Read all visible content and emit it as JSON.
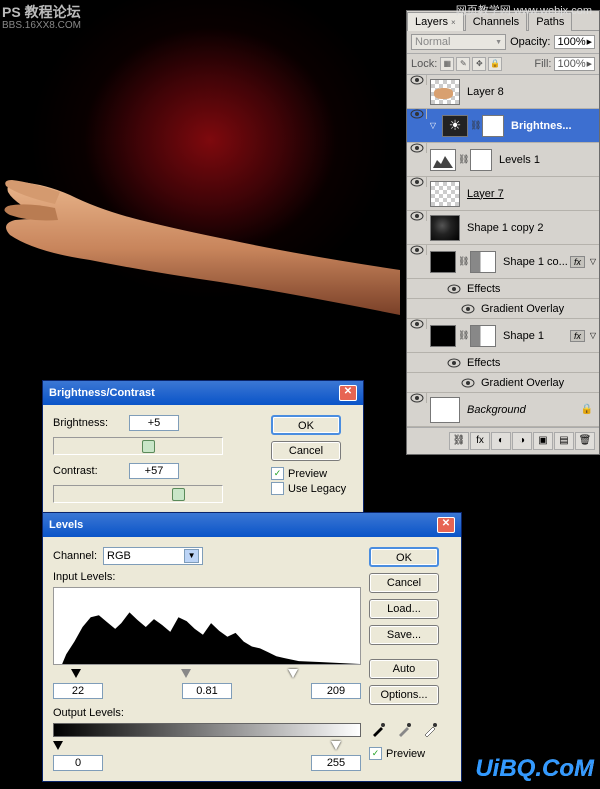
{
  "watermarks": {
    "top_left": "PS 教程论坛",
    "top_left_sub": "BBS.16XX8.COM",
    "top_right": "网页教学网\nwww.webjx.com",
    "bottom_right": "UiBQ.CoM"
  },
  "brightness_contrast": {
    "title": "Brightness/Contrast",
    "brightness_label": "Brightness:",
    "brightness_value": "+5",
    "contrast_label": "Contrast:",
    "contrast_value": "+57",
    "ok": "OK",
    "cancel": "Cancel",
    "preview": "Preview",
    "use_legacy": "Use Legacy"
  },
  "levels": {
    "title": "Levels",
    "channel_label": "Channel:",
    "channel_value": "RGB",
    "input_label": "Input Levels:",
    "input_black": "22",
    "input_mid": "0.81",
    "input_white": "209",
    "output_label": "Output Levels:",
    "output_black": "0",
    "output_white": "255",
    "ok": "OK",
    "cancel": "Cancel",
    "load": "Load...",
    "save": "Save...",
    "auto": "Auto",
    "options": "Options...",
    "preview": "Preview"
  },
  "layers_panel": {
    "tabs": {
      "layers": "Layers",
      "channels": "Channels",
      "paths": "Paths"
    },
    "blend_mode": "Normal",
    "opacity_label": "Opacity:",
    "opacity_value": "100%",
    "lock_label": "Lock:",
    "fill_label": "Fill:",
    "fill_value": "100%",
    "layers": [
      {
        "name": "Layer 8",
        "type": "raster"
      },
      {
        "name": "Brightnes...",
        "type": "adjust",
        "selected": true
      },
      {
        "name": "Levels 1",
        "type": "adjust"
      },
      {
        "name": "Layer 7",
        "type": "raster",
        "underline": true
      },
      {
        "name": "Shape 1 copy 2",
        "type": "raster"
      },
      {
        "name": "Shape 1 co...",
        "type": "shape",
        "fx": true
      },
      {
        "name": "Shape 1",
        "type": "shape",
        "fx": true
      },
      {
        "name": "Background",
        "type": "bg",
        "locked": true
      }
    ],
    "effects_label": "Effects",
    "gradient_overlay_label": "Gradient Overlay"
  }
}
